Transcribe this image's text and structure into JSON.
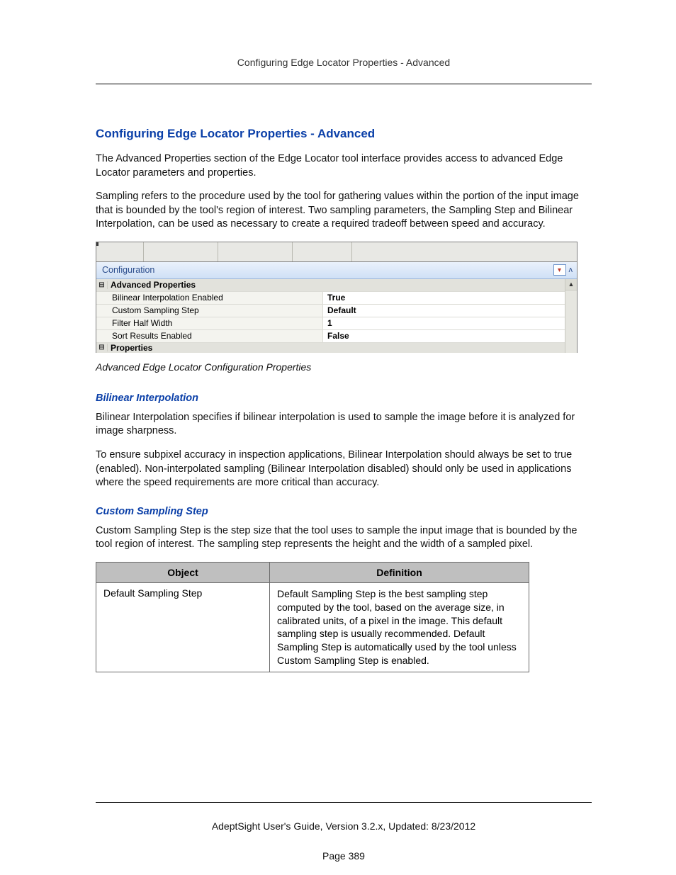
{
  "header": {
    "running_head": "Configuring Edge Locator Properties - Advanced"
  },
  "title": "Configuring Edge Locator Properties - Advanced",
  "intro_para_1": "The Advanced Properties section of the Edge Locator tool interface provides access to advanced Edge Locator parameters and properties.",
  "intro_para_2": "Sampling refers to the procedure used by the tool for gathering values within the portion of the input image that is bounded by the tool's region of interest. Two sampling parameters, the Sampling Step and Bilinear Interpolation, can be used as necessary to create a required tradeoff between speed and accuracy.",
  "propgrid": {
    "panel_label": "Configuration",
    "group_main": "Advanced Properties",
    "rows": [
      {
        "key": "Bilinear Interpolation Enabled",
        "val": "True"
      },
      {
        "key": "Custom Sampling Step",
        "val": "Default"
      },
      {
        "key": "Filter Half Width",
        "val": "1"
      },
      {
        "key": "Sort Results Enabled",
        "val": "False"
      }
    ],
    "group_cut": "Properties"
  },
  "caption": "Advanced Edge Locator Configuration Properties",
  "sections": {
    "bilinear": {
      "heading": "Bilinear Interpolation",
      "p1": "Bilinear Interpolation specifies if bilinear interpolation is used to sample the image before it is analyzed for image sharpness.",
      "p2": "To ensure subpixel accuracy in inspection applications, Bilinear Interpolation should always be set to true (enabled). Non-interpolated sampling (Bilinear Interpolation disabled) should only be used in applications where the speed requirements are more critical than accuracy."
    },
    "custom": {
      "heading": "Custom Sampling Step",
      "p1": "Custom Sampling Step is the step size that the tool uses to sample the input image that is bounded by the tool region of interest. The sampling step represents the height and the width of a sampled pixel."
    }
  },
  "deftable": {
    "col1": "Object",
    "col2": "Definition",
    "row1_obj": "Default Sampling Step",
    "row1_def": "Default Sampling Step is the best sampling step computed by the tool, based on the average size, in calibrated units, of a pixel in the image. This default sampling step is usually recommended. Default Sampling Step is automatically used by the tool unless Custom Sampling Step is enabled."
  },
  "footer": {
    "line1": "AdeptSight User's Guide,  Version 3.2.x, Updated: 8/23/2012",
    "line2": "Page 389"
  }
}
